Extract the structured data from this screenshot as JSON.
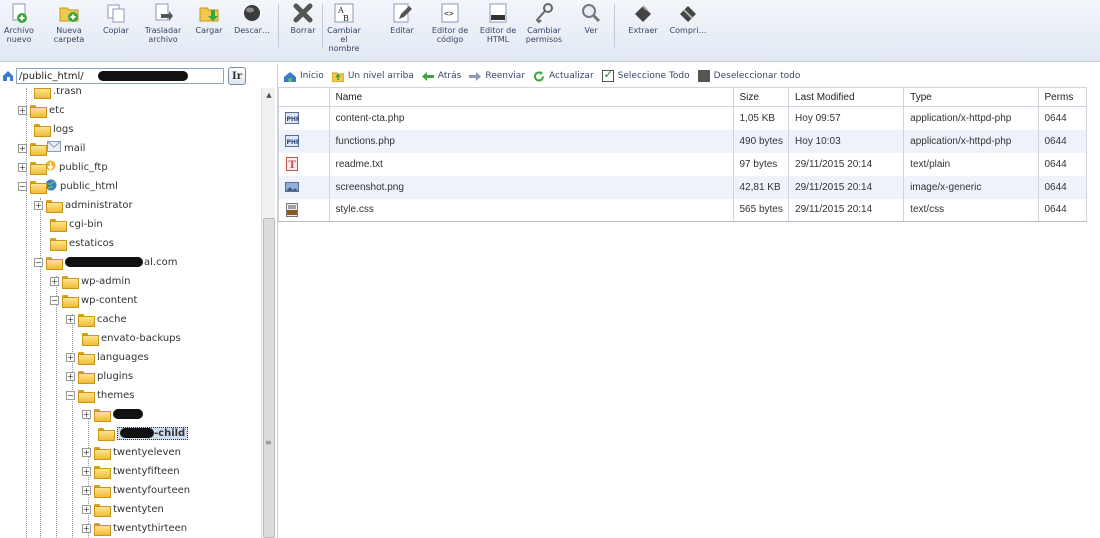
{
  "toolbar": {
    "new_file": "Archivo nuevo",
    "new_folder": "Nueva carpeta",
    "copy": "Copiar",
    "move": "Trasladar archivo",
    "upload": "Cargar",
    "download": "Descar…",
    "delete": "Borrar",
    "rename": "Cambiar el nombre",
    "edit": "Editar",
    "code_editor": "Editor de código",
    "html_editor": "Editor de HTML",
    "permissions": "Cambiar permisos",
    "view": "Ver",
    "extract": "Extraer",
    "compress": "Compri…"
  },
  "pathbar": {
    "path": "/public_html/                    /wp-co",
    "go_label": "Ir"
  },
  "tree": [
    {
      "label": ".trash"
    },
    {
      "label": "etc"
    },
    {
      "label": "logs"
    },
    {
      "label": "mail"
    },
    {
      "label": "public_ftp"
    },
    {
      "label": "public_html"
    },
    {
      "label": "administrator"
    },
    {
      "label": "cgi-bin"
    },
    {
      "label": "estaticos"
    },
    {
      "label": "al.com"
    },
    {
      "label": "wp-admin"
    },
    {
      "label": "wp-content"
    },
    {
      "label": "cache"
    },
    {
      "label": "envato-backups"
    },
    {
      "label": "languages"
    },
    {
      "label": "plugins"
    },
    {
      "label": "themes"
    },
    {
      "label": ""
    },
    {
      "label": "-child"
    },
    {
      "label": "twentyeleven"
    },
    {
      "label": "twentyfifteen"
    },
    {
      "label": "twentyfourteen"
    },
    {
      "label": "twentyten"
    },
    {
      "label": "twentythirteen"
    }
  ],
  "nav": {
    "home": "Inicio",
    "up": "Un nivel arriba",
    "back": "Atrás",
    "forward": "Reenviar",
    "reload": "Actualizar",
    "select_all": "Seleccione Todo",
    "deselect_all": "Deseleccionar todo"
  },
  "table": {
    "headers": [
      "Name",
      "Size",
      "Last Modified",
      "Type",
      "Perms"
    ],
    "rows": [
      {
        "icon": "php-icon",
        "name": "content-cta.php",
        "size": "1,05 KB",
        "modified": "Hoy 09:57",
        "type": "application/x-httpd-php",
        "perms": "0644"
      },
      {
        "icon": "php-icon",
        "name": "functions.php",
        "size": "490 bytes",
        "modified": "Hoy 10:03",
        "type": "application/x-httpd-php",
        "perms": "0644"
      },
      {
        "icon": "text-icon",
        "name": "readme.txt",
        "size": "97 bytes",
        "modified": "29/11/2015 20:14",
        "type": "text/plain",
        "perms": "0644"
      },
      {
        "icon": "image-icon",
        "name": "screenshot.png",
        "size": "42,81 KB",
        "modified": "29/11/2015 20:14",
        "type": "image/x-generic",
        "perms": "0644"
      },
      {
        "icon": "css-icon",
        "name": "style.css",
        "size": "565 bytes",
        "modified": "29/11/2015 20:14",
        "type": "text/css",
        "perms": "0644"
      }
    ]
  }
}
